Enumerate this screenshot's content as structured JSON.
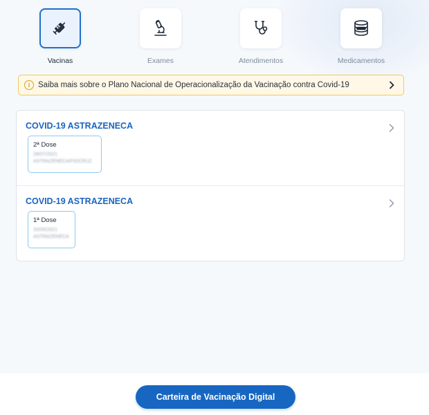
{
  "categories": [
    {
      "label": "Vacinas",
      "icon": "syringe-icon",
      "active": true
    },
    {
      "label": "Exames",
      "icon": "microscope-icon",
      "active": false
    },
    {
      "label": "Atendimentos",
      "icon": "stethoscope-icon",
      "active": false
    },
    {
      "label": "Medicamentos",
      "icon": "pills-container-icon",
      "active": false
    }
  ],
  "banner": {
    "text": "Saiba mais sobre o Plano Nacional de Operacionalização da Vacinação contra Covid-19",
    "icon": "info-icon",
    "chevron": "chevron-right-icon"
  },
  "vaccines": [
    {
      "title": "COVID-19 ASTRAZENECA",
      "dose": {
        "label": "2ª Dose",
        "date": "28/07/2021",
        "detail": "ASTRAZENECA/FIOCRUZ"
      }
    },
    {
      "title": "COVID-19 ASTRAZENECA",
      "dose": {
        "label": "1ª Dose",
        "date": "20/05/2021",
        "detail": "ASTRAZENECA"
      }
    }
  ],
  "cta": {
    "label": "Carteira de Vacinação Digital"
  },
  "colors": {
    "primary": "#1766c1",
    "title_blue": "#1a64c0",
    "banner_bg": "#fff8e7",
    "banner_border": "#f0c95a",
    "dose_border": "#8cc9ef"
  }
}
